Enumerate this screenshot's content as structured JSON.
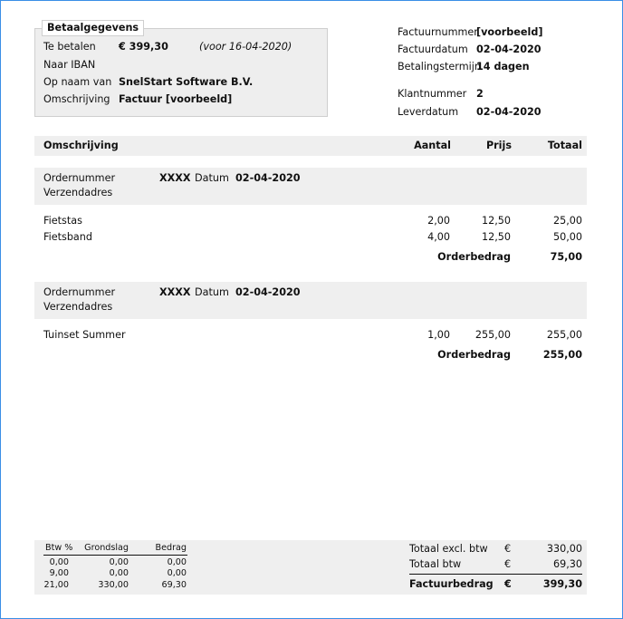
{
  "payment": {
    "title": "Betaalgegevens",
    "rows": [
      {
        "label": "Te betalen",
        "value": "€ 399,30",
        "note": "(voor 16-04-2020)"
      },
      {
        "label": "Naar IBAN",
        "value": ""
      },
      {
        "label": "Op naam van",
        "value": "SnelStart Software B.V."
      },
      {
        "label": "Omschrijving",
        "value": "Factuur [voorbeeld]"
      }
    ]
  },
  "invoice_info": [
    {
      "label": "Factuurnummer",
      "value": "[voorbeeld]"
    },
    {
      "label": "Factuurdatum",
      "value": "02-04-2020"
    },
    {
      "label": "Betalingstermijn",
      "value": "14 dagen"
    },
    {
      "label": "Klantnummer",
      "value": "2"
    },
    {
      "label": "Leverdatum",
      "value": "02-04-2020"
    }
  ],
  "table_header": {
    "description": "Omschrijving",
    "qty": "Aantal",
    "price": "Prijs",
    "total": "Totaal"
  },
  "orders": [
    {
      "order_label": "Ordernummer",
      "order_no": "XXXX",
      "date_label": "Datum",
      "date": "02-04-2020",
      "address_label": "Verzendadres",
      "lines": [
        {
          "description": "Fietstas",
          "qty": "2,00",
          "price": "12,50",
          "total": "25,00"
        },
        {
          "description": "Fietsband",
          "qty": "4,00",
          "price": "12,50",
          "total": "50,00"
        }
      ],
      "subtotal_label": "Orderbedrag",
      "subtotal": "75,00"
    },
    {
      "order_label": "Ordernummer",
      "order_no": "XXXX",
      "date_label": "Datum",
      "date": "02-04-2020",
      "address_label": "Verzendadres",
      "lines": [
        {
          "description": "Tuinset Summer",
          "qty": "1,00",
          "price": "255,00",
          "total": "255,00"
        }
      ],
      "subtotal_label": "Orderbedrag",
      "subtotal": "255,00"
    }
  ],
  "vat": {
    "headers": [
      "Btw %",
      "Grondslag",
      "Bedrag"
    ],
    "rows": [
      [
        "0,00",
        "0,00",
        "0,00"
      ],
      [
        "9,00",
        "0,00",
        "0,00"
      ],
      [
        "21,00",
        "330,00",
        "69,30"
      ]
    ]
  },
  "totals": [
    {
      "label": "Totaal excl. btw",
      "currency": "€",
      "value": "330,00"
    },
    {
      "label": "Totaal btw",
      "currency": "€",
      "value": "69,30"
    },
    {
      "label": "Factuurbedrag",
      "currency": "€",
      "value": "399,30"
    }
  ]
}
